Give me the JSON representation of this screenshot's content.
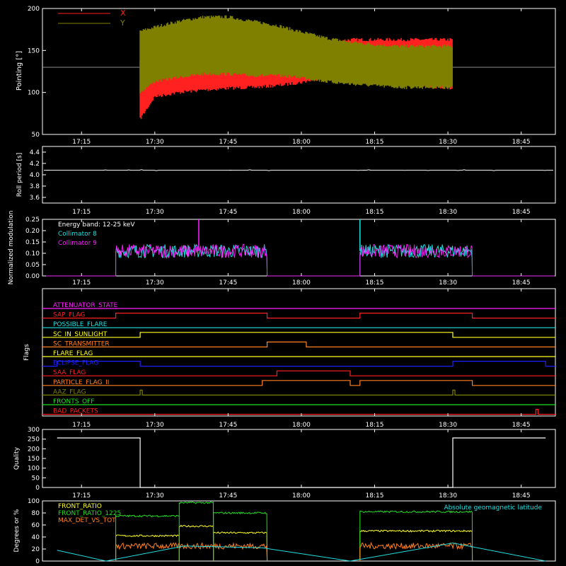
{
  "colors": {
    "background": "#000000",
    "axes": "#ffffff",
    "red": "#ff2020",
    "olive": "#808000",
    "cyan": "#20e0e0",
    "magenta": "#ff20ff",
    "yellow": "#ffff20",
    "green": "#20e020",
    "blue": "#2020ff",
    "orange": "#ff8020",
    "white": "#ffffff"
  },
  "chart_data": [
    {
      "type": "line",
      "id": "pointing",
      "ylabel": "Pointing [°]",
      "ylim": [
        50,
        200
      ],
      "yticks": [
        50,
        100,
        150,
        200
      ],
      "xticks": [
        "17:15",
        "17:30",
        "17:45",
        "18:00",
        "18:15",
        "18:30",
        "18:45"
      ],
      "legend": [
        "X",
        "Y"
      ],
      "series": [
        {
          "name": "X",
          "color": "#ff2020",
          "data_start": "17:27",
          "data_end": "18:31",
          "x": [
            "17:27",
            "17:30",
            "17:35",
            "17:40",
            "17:45",
            "17:50",
            "17:55",
            "18:00",
            "18:05",
            "18:10",
            "18:15",
            "18:20",
            "18:25",
            "18:31"
          ],
          "min": [
            68,
            95,
            100,
            103,
            105,
            106,
            108,
            112,
            118,
            120,
            118,
            113,
            108,
            105
          ],
          "max": [
            140,
            145,
            155,
            162,
            168,
            168,
            165,
            158,
            160,
            163,
            163,
            163,
            163,
            163
          ]
        },
        {
          "name": "Y",
          "color": "#808000",
          "data_start": "17:27",
          "data_end": "18:31",
          "x": [
            "17:27",
            "17:30",
            "17:35",
            "17:40",
            "17:45",
            "17:50",
            "17:55",
            "18:00",
            "18:05",
            "18:10",
            "18:15",
            "18:20",
            "18:25",
            "18:31"
          ],
          "min": [
            100,
            113,
            118,
            122,
            122,
            120,
            120,
            118,
            113,
            110,
            108,
            106,
            106,
            106
          ],
          "max": [
            173,
            178,
            185,
            190,
            190,
            185,
            180,
            172,
            165,
            160,
            157,
            155,
            155,
            155
          ]
        }
      ],
      "reference_line": 130
    },
    {
      "type": "line",
      "id": "roll_period",
      "ylabel": "Roll period [s]",
      "ylim": [
        3.5,
        4.5
      ],
      "yticks": [
        3.6,
        3.8,
        4.0,
        4.2,
        4.4
      ],
      "xticks": [
        "17:15",
        "17:30",
        "17:45",
        "18:00",
        "18:15",
        "18:30",
        "18:45"
      ],
      "series": [
        {
          "name": "",
          "color": "#ffffff",
          "value": 4.08
        }
      ]
    },
    {
      "type": "line",
      "id": "modulation",
      "ylabel": "Normalized modulation",
      "ylim": [
        0,
        0.25
      ],
      "yticks": [
        0.0,
        0.05,
        0.1,
        0.15,
        0.2,
        0.25
      ],
      "xticks": [
        "17:15",
        "17:30",
        "17:45",
        "18:00",
        "18:15",
        "18:30",
        "18:45"
      ],
      "annotation": "Energy band: 12-25 keV",
      "legend": [
        "Collimator 8",
        "Collimator 9"
      ],
      "series": [
        {
          "name": "Collimator 8",
          "color": "#20e0e0"
        },
        {
          "name": "Collimator 9",
          "color": "#ff20ff"
        }
      ],
      "active_intervals": [
        [
          "17:22",
          "17:53"
        ],
        [
          "18:12",
          "18:35"
        ]
      ],
      "level": 0.11,
      "spikes": [
        {
          "x": "17:39",
          "y": 0.25,
          "series": "Collimator 9"
        },
        {
          "x": "18:12",
          "y": 0.25,
          "series": "Collimator 8"
        }
      ]
    },
    {
      "type": "line",
      "id": "flags",
      "ylabel": "Flags",
      "xticks": [
        "17:15",
        "17:30",
        "17:45",
        "18:00",
        "18:15",
        "18:30",
        "18:45"
      ],
      "series": [
        {
          "name": "ATTENUATOR_STATE",
          "color": "#ff20ff",
          "changes": []
        },
        {
          "name": "SAP_FLAG",
          "color": "#ff2020",
          "changes": [
            [
              "17:22",
              "17:53"
            ],
            [
              "18:12",
              "18:35"
            ]
          ]
        },
        {
          "name": "POSSIBLE_FLARE",
          "color": "#20e0e0",
          "changes": []
        },
        {
          "name": "SC_IN_SUNLIGHT",
          "color": "#ffff20",
          "changes": [
            [
              "17:27",
              "18:31"
            ]
          ]
        },
        {
          "name": "SC_TRANSMITTER",
          "color": "#ff8020",
          "changes": [
            [
              "17:53",
              "18:01"
            ]
          ]
        },
        {
          "name": "FLARE_FLAG",
          "color": "#ffff20",
          "changes": []
        },
        {
          "name": "ECLIPSE_FLAG",
          "color": "#2020ff",
          "changes": [
            [
              "17:10",
              "17:27"
            ],
            [
              "18:31",
              "18:50"
            ]
          ]
        },
        {
          "name": "SAA_FLAG",
          "color": "#ff2020",
          "changes": [
            [
              "17:55",
              "18:10"
            ]
          ]
        },
        {
          "name": "PARTICLE_FLAG_II",
          "color": "#ff8020",
          "changes": [
            [
              "17:52",
              "18:10"
            ],
            [
              "18:12",
              "18:35"
            ]
          ]
        },
        {
          "name": "AAZ_FLAG",
          "color": "#808000",
          "changes": [
            [
              "17:27",
              "17:27"
            ],
            [
              "18:31",
              "18:31"
            ]
          ]
        },
        {
          "name": "FRONTS_OFF",
          "color": "#20e020",
          "changes": []
        },
        {
          "name": "BAD_PACKETS",
          "color": "#ff2020",
          "changes": [
            [
              "18:48",
              "18:48"
            ]
          ]
        }
      ]
    },
    {
      "type": "line",
      "id": "quality",
      "ylabel": "Quality",
      "ylim": [
        0,
        300
      ],
      "yticks": [
        0,
        50,
        100,
        150,
        200,
        250,
        300
      ],
      "xticks": [
        "17:15",
        "17:30",
        "17:45",
        "18:00",
        "18:15",
        "18:30",
        "18:45"
      ],
      "series": [
        {
          "name": "",
          "color": "#ffffff",
          "x": [
            "17:10",
            "17:27",
            "17:27",
            "18:31",
            "18:31",
            "18:50"
          ],
          "y": [
            256,
            256,
            0,
            0,
            256,
            256
          ]
        }
      ]
    },
    {
      "type": "line",
      "id": "ratios",
      "ylabel": "Degrees or %",
      "ylim": [
        0,
        100
      ],
      "yticks": [
        0,
        20,
        40,
        60,
        80,
        100
      ],
      "legend": [
        "FRONT_RATIO",
        "FRONT_RATIO_1225",
        "MAX_DET_VS_TOT"
      ],
      "annotation": "Absolute geomagnetic latitude",
      "series": [
        {
          "name": "FRONT_RATIO",
          "color": "#ffff20",
          "segments": [
            [
              [
                "17:22",
                "17:35"
              ],
              42
            ],
            [
              [
                "17:35",
                "17:42"
              ],
              58
            ],
            [
              [
                "17:42",
                "17:53"
              ],
              47
            ],
            [
              [
                "18:12",
                "18:35"
              ],
              50
            ]
          ]
        },
        {
          "name": "FRONT_RATIO_1225",
          "color": "#20e020",
          "segments": [
            [
              [
                "17:22",
                "17:35"
              ],
              75
            ],
            [
              [
                "17:35",
                "17:42"
              ],
              97
            ],
            [
              [
                "17:42",
                "17:53"
              ],
              80
            ],
            [
              [
                "18:12",
                "18:35"
              ],
              82
            ]
          ]
        },
        {
          "name": "MAX_DET_VS_TOT",
          "color": "#ff8020",
          "segments": [
            [
              [
                "17:22",
                "17:53"
              ],
              25
            ],
            [
              [
                "18:12",
                "18:35"
              ],
              25
            ]
          ]
        },
        {
          "name": "Absolute geomagnetic latitude",
          "color": "#20e0e0",
          "x": [
            "17:10",
            "17:20",
            "17:36",
            "17:52",
            "18:10",
            "18:31",
            "18:50"
          ],
          "y": [
            18,
            0,
            25,
            22,
            0,
            30,
            0
          ]
        }
      ]
    }
  ]
}
